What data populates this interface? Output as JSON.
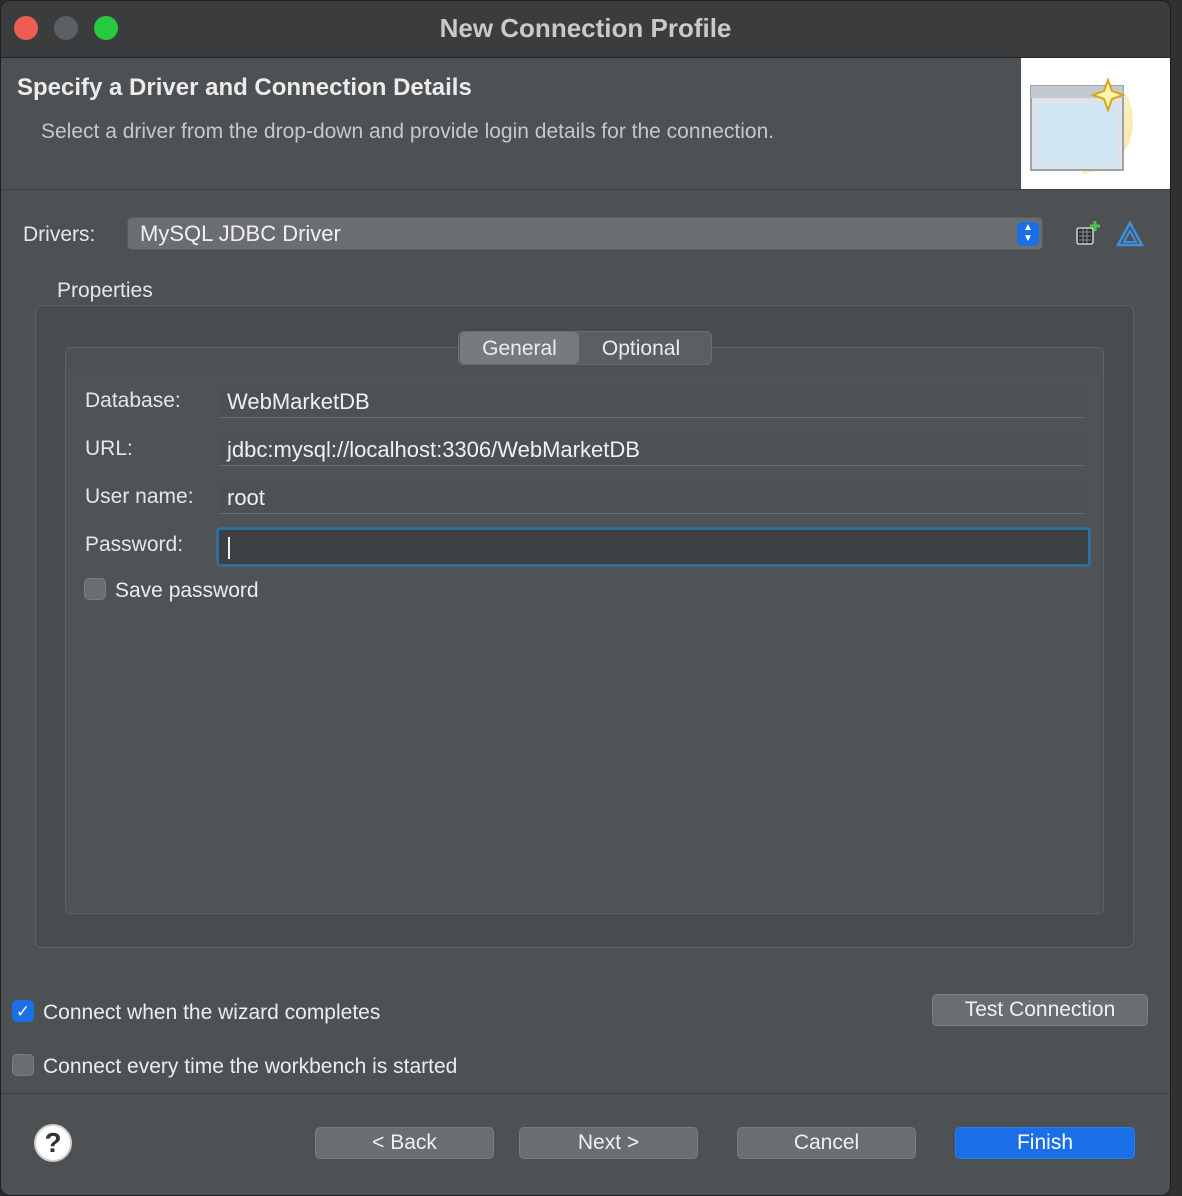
{
  "window": {
    "title": "New Connection Profile"
  },
  "header": {
    "title": "Specify a Driver and Connection Details",
    "description": "Select a driver from the drop-down and provide login details for the connection."
  },
  "drivers": {
    "label": "Drivers:",
    "selected": "MySQL JDBC Driver"
  },
  "properties": {
    "label": "Properties",
    "tabs": [
      {
        "label": "General",
        "selected": true
      },
      {
        "label": "Optional",
        "selected": false
      }
    ],
    "fields": {
      "database": {
        "label": "Database:",
        "value": "WebMarketDB"
      },
      "url": {
        "label": "URL:",
        "value": "jdbc:mysql://localhost:3306/WebMarketDB"
      },
      "username": {
        "label": "User name:",
        "value": "root"
      },
      "password": {
        "label": "Password:",
        "value": ""
      }
    },
    "save_password": {
      "label": "Save password",
      "checked": false
    }
  },
  "options": {
    "connect_on_complete": {
      "label": "Connect when the wizard completes",
      "checked": true
    },
    "connect_on_startup": {
      "label": "Connect every time the workbench is started",
      "checked": false
    },
    "test_connection_label": "Test Connection"
  },
  "footer": {
    "back_label": "< Back",
    "next_label": "Next >",
    "cancel_label": "Cancel",
    "finish_label": "Finish"
  },
  "icons": {
    "new_driver": "new-driver-definition-icon",
    "edit_driver": "edit-driver-definition-icon",
    "help": "help-icon",
    "wizard_banner": "wizard-banner-icon"
  },
  "colors": {
    "accent": "#1b6fe6",
    "focus_ring": "#2f6f9e",
    "window_bg": "#4d5154"
  }
}
